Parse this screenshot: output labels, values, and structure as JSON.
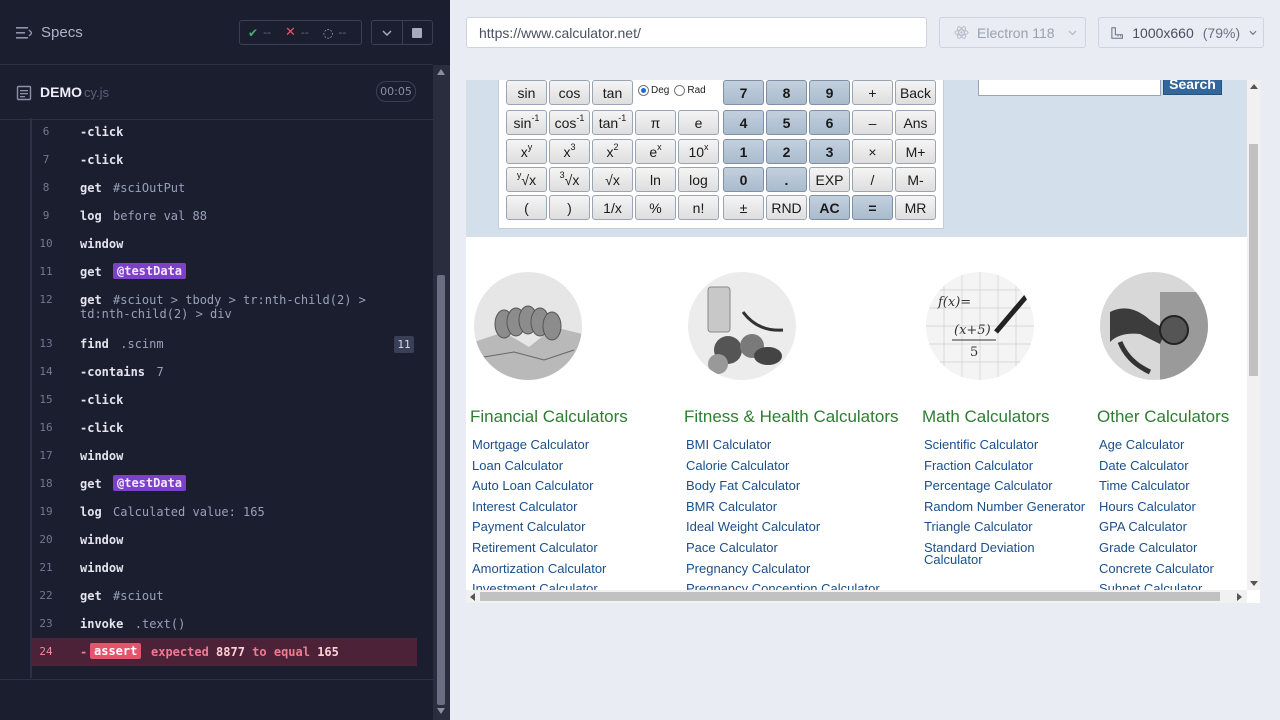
{
  "reporter": {
    "specs_label": "Specs",
    "stats": {
      "passed": "--",
      "failed": "--",
      "pending": "--"
    },
    "file": {
      "name": "DEMO",
      "ext": "cy.js",
      "duration": "00:05"
    },
    "commands": [
      {
        "num": "6",
        "name": "-click",
        "msg": ""
      },
      {
        "num": "7",
        "name": "-click",
        "msg": ""
      },
      {
        "num": "8",
        "name": "get",
        "msg": "#sciOutPut"
      },
      {
        "num": "9",
        "name": "log",
        "msg": "before val 88"
      },
      {
        "num": "10",
        "name": "window",
        "msg": ""
      },
      {
        "num": "11",
        "name": "get",
        "alias": "@testData"
      },
      {
        "num": "12",
        "name": "get",
        "msg": "#sciout > tbody > tr:nth-child(2) >",
        "msg2": "td:nth-child(2) > div"
      },
      {
        "num": "13",
        "name": "find",
        "msg": ".scinm",
        "badge": "11"
      },
      {
        "num": "14",
        "name": "-contains",
        "msg": "7"
      },
      {
        "num": "15",
        "name": "-click",
        "msg": ""
      },
      {
        "num": "16",
        "name": "-click",
        "msg": ""
      },
      {
        "num": "17",
        "name": "window",
        "msg": ""
      },
      {
        "num": "18",
        "name": "get",
        "alias": "@testData"
      },
      {
        "num": "19",
        "name": "log",
        "msg": "Calculated value: 165"
      },
      {
        "num": "20",
        "name": "window",
        "msg": ""
      },
      {
        "num": "21",
        "name": "window",
        "msg": ""
      },
      {
        "num": "22",
        "name": "get",
        "msg": "#sciout"
      },
      {
        "num": "23",
        "name": "invoke",
        "msg": ".text()"
      }
    ],
    "failed_command": {
      "num": "24",
      "dash": "-",
      "tag": "assert",
      "expected": "expected",
      "actual_value": "8877",
      "to_equal": "to equal",
      "expected_value": "165"
    }
  },
  "browser": {
    "url": "https://www.calculator.net/",
    "browser_name": "Electron 118",
    "viewport": "1000x660",
    "zoom": "(79%)"
  },
  "calculator": {
    "deg_label": "Deg",
    "rad_label": "Rad",
    "search_label": "Search",
    "rows": [
      [
        "sin",
        "cos",
        "tan",
        "",
        "7",
        "8",
        "9",
        "+",
        "Back"
      ],
      [
        "sin-1",
        "cos-1",
        "tan-1",
        "π",
        "e",
        "4",
        "5",
        "6",
        "–",
        "Ans"
      ],
      [
        "xy",
        "x3",
        "x2",
        "ex",
        "10x",
        "1",
        "2",
        "3",
        "×",
        "M+"
      ],
      [
        "y√x",
        "3√x",
        "√x",
        "ln",
        "log",
        "0",
        ".",
        "EXP",
        "/",
        "M-"
      ],
      [
        "(",
        ")",
        "1/x",
        "%",
        "n!",
        "±",
        "RND",
        "AC",
        "=",
        "MR"
      ]
    ]
  },
  "categories": [
    {
      "title": "Financial Calculators",
      "image": "coins-image",
      "links": [
        "Mortgage Calculator",
        "Loan Calculator",
        "Auto Loan Calculator",
        "Interest Calculator",
        "Payment Calculator",
        "Retirement Calculator",
        "Amortization Calculator",
        "Investment Calculator"
      ]
    },
    {
      "title": "Fitness & Health Calculators",
      "image": "health-image",
      "links": [
        "BMI Calculator",
        "Calorie Calculator",
        "Body Fat Calculator",
        "BMR Calculator",
        "Ideal Weight Calculator",
        "Pace Calculator",
        "Pregnancy Calculator",
        "Pregnancy Conception Calculator"
      ]
    },
    {
      "title": "Math Calculators",
      "image": "math-image",
      "links": [
        "Scientific Calculator",
        "Fraction Calculator",
        "Percentage Calculator",
        "Random Number Generator",
        "Triangle Calculator",
        "Standard Deviation",
        "Calculator"
      ]
    },
    {
      "title": "Other Calculators",
      "image": "fuel-image",
      "links": [
        "Age Calculator",
        "Date Calculator",
        "Time Calculator",
        "Hours Calculator",
        "GPA Calculator",
        "Grade Calculator",
        "Concrete Calculator",
        "Subnet Calculator"
      ]
    }
  ],
  "colors": {
    "fail": "#e4556c",
    "alias": "#7d40c8",
    "link": "#1a4f8a",
    "category_title": "#2e7d32",
    "search_button": "#336699"
  }
}
